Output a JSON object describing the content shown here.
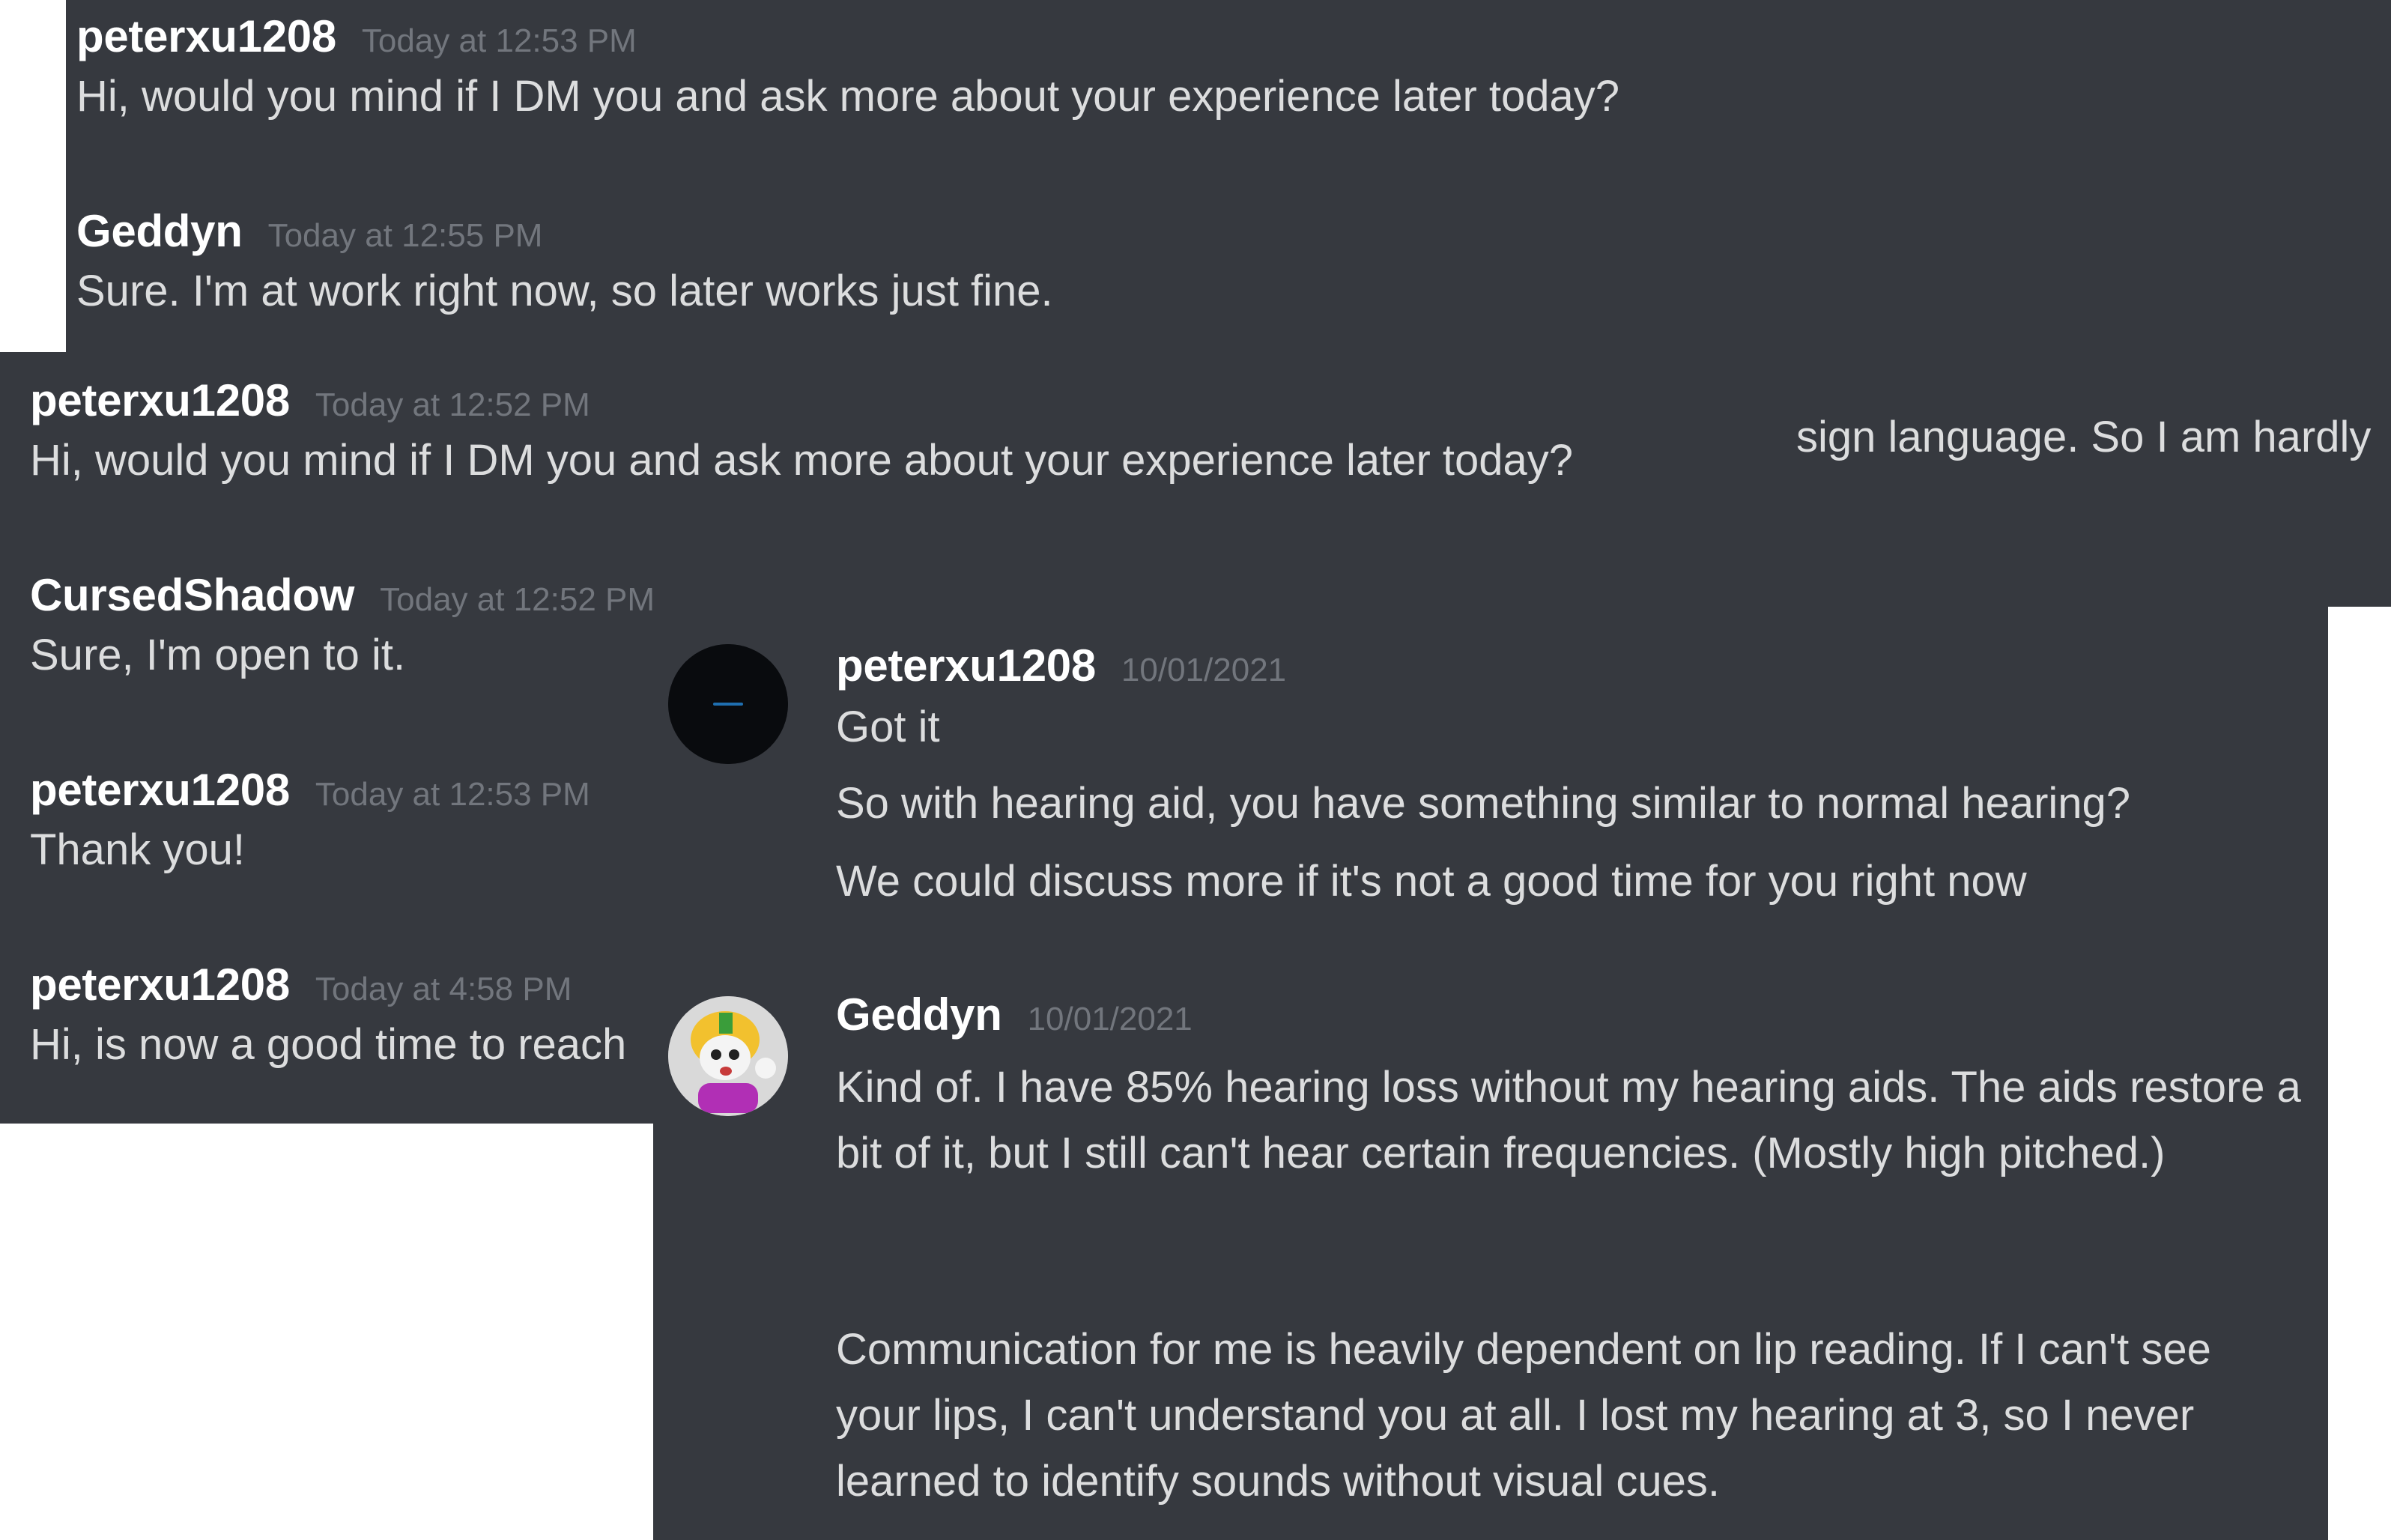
{
  "panel_top": {
    "messages": [
      {
        "username": "peterxu1208",
        "timestamp": "Today at 12:53 PM",
        "text": "Hi, would you mind if I DM you and ask more about your experience later today?"
      },
      {
        "username": "Geddyn",
        "timestamp": "Today at 12:55 PM",
        "text": "Sure. I'm at work right now, so later works just fine."
      }
    ]
  },
  "panel_left": {
    "messages": [
      {
        "username": "peterxu1208",
        "timestamp": "Today at 12:52 PM",
        "text": "Hi, would you mind if I DM you and ask more about your experience later today?"
      },
      {
        "username": "CursedShadow",
        "timestamp": "Today at 12:52 PM",
        "text": "Sure, I'm open to it."
      },
      {
        "username": "peterxu1208",
        "timestamp": "Today at 12:53 PM",
        "text": "Thank you!"
      },
      {
        "username": "peterxu1208",
        "timestamp": "Today at 4:58 PM",
        "text": "Hi, is now a good time to reach"
      }
    ],
    "partial_text": "sign language. So I am hardly"
  },
  "panel_dm": {
    "messages": [
      {
        "username": "peterxu1208",
        "timestamp": "10/01/2021",
        "avatar": "dark-avatar",
        "lines": [
          "Got it",
          "So with hearing aid, you have something similar to normal hearing?",
          "We could discuss more if it's not a good time for you right now"
        ]
      },
      {
        "username": "Geddyn",
        "timestamp": "10/01/2021",
        "avatar": "cartoon-helmet-avatar",
        "paragraphs": [
          "Kind of. I have 85% hearing loss without my hearing aids. The aids restore a bit of it, but I still can't hear certain frequencies. (Mostly high pitched.)",
          "Communication for me is heavily dependent on lip reading. If I can't see your lips, I can't understand you at all. I lost my hearing at 3, so I never learned to identify sounds without visual cues."
        ]
      }
    ]
  },
  "colors": {
    "panel_bg": "#36393f",
    "username": "#ffffff",
    "text": "#dcddde",
    "timestamp": "#72767d",
    "page_bg": "#ffffff"
  }
}
